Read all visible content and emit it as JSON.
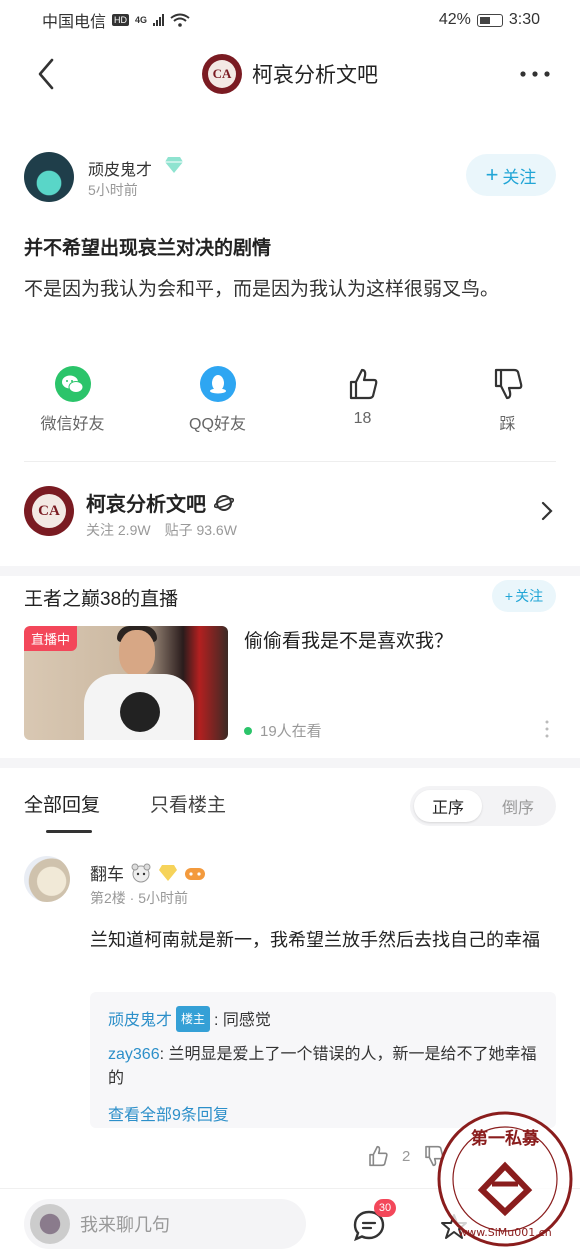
{
  "status_bar": {
    "carrier": "中国电信",
    "hd": "HD",
    "network": "4G",
    "battery": "42%",
    "time": "3:30"
  },
  "nav": {
    "title": "柯哀分析文吧",
    "logo_text": "CA"
  },
  "post": {
    "author_name": "顽皮鬼才",
    "time_ago": "5小时前",
    "follow_label": "关注",
    "title": "并不希望出现哀兰对决的剧情",
    "body": "不是因为我认为会和平，而是因为我认为这样很弱叉鸟。"
  },
  "actions": [
    {
      "label": "微信好友",
      "icon": "wechat-icon"
    },
    {
      "label": "QQ好友",
      "icon": "qq-icon"
    },
    {
      "label": "18",
      "icon": "thumbs-up-icon"
    },
    {
      "label": "踩",
      "icon": "thumbs-down-icon"
    }
  ],
  "forum": {
    "name": "柯哀分析文吧",
    "followers_label": "关注",
    "followers": "2.9W",
    "posts_label": "贴子",
    "posts": "93.6W"
  },
  "live": {
    "title": "王者之巅38的直播",
    "follow_label": "关注",
    "badge": "直播中",
    "description": "偷偷看我是不是喜欢我？",
    "viewers": "19人在看"
  },
  "replies": {
    "tab_all": "全部回复",
    "tab_owner": "只看楼主",
    "sort_asc": "正序",
    "sort_desc": "倒序"
  },
  "comment": {
    "user": "翻车",
    "floor": "第2楼",
    "time_ago": "5小时前",
    "text": "兰知道柯南就是新一，我希望兰放手然后去找自己的幸福",
    "sub_replies": [
      {
        "user": "顽皮鬼才",
        "tag": "楼主",
        "text": "同感觉"
      },
      {
        "user": "zay366",
        "tag": "",
        "text": "兰明显是爱上了一个错误的人，新一是给不了她幸福的"
      }
    ],
    "view_all": "查看全部9条回复",
    "likes": "2"
  },
  "bottom_bar": {
    "placeholder": "我来聊几句",
    "comment_badge": "30"
  },
  "watermark": {
    "text_top": "第一私募",
    "text_bottom": "www.SiMu001.cn"
  },
  "colors": {
    "accent": "#21a5d6",
    "link": "#2c8fc9",
    "live_red": "#f3475a",
    "forum_maroon": "#7a1b22"
  }
}
